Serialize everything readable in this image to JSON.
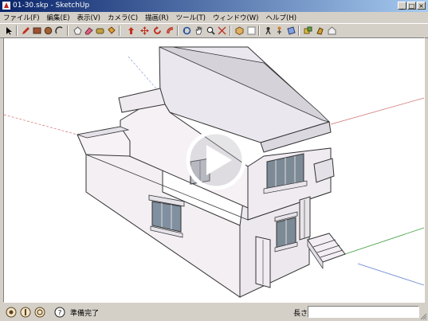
{
  "window": {
    "title": "01-30.skp - SketchUp",
    "controls": {
      "minimize": "_",
      "maximize": "□",
      "close": "×"
    }
  },
  "menu": [
    "ファイル(F)",
    "編集(E)",
    "表示(V)",
    "カメラ(C)",
    "描画(R)",
    "ツール(T)",
    "ウィンドウ(W)",
    "ヘルプ(H)"
  ],
  "toolbar": {
    "tools": [
      {
        "name": "select-icon"
      },
      {
        "name": "pencil-icon"
      },
      {
        "name": "rectangle-icon"
      },
      {
        "name": "circle-icon"
      },
      {
        "name": "arc-icon"
      },
      {
        "name": "polygon-icon"
      },
      {
        "name": "eraser-icon"
      },
      {
        "name": "tape-measure-icon"
      },
      {
        "name": "paint-bucket-icon"
      },
      {
        "name": "push-pull-icon"
      },
      {
        "name": "move-icon"
      },
      {
        "name": "rotate-icon"
      },
      {
        "name": "offset-icon"
      },
      {
        "name": "orbit-icon"
      },
      {
        "name": "pan-icon"
      },
      {
        "name": "zoom-icon"
      },
      {
        "name": "zoom-extents-icon"
      },
      {
        "name": "iso-view-icon"
      },
      {
        "name": "walk-icon"
      },
      {
        "name": "look-around-icon"
      },
      {
        "name": "position-camera-icon"
      },
      {
        "name": "section-plane-icon"
      },
      {
        "name": "components-icon"
      },
      {
        "name": "materials-icon"
      },
      {
        "name": "warehouse-icon"
      }
    ]
  },
  "statusbar": {
    "status_text": "準備完了",
    "length_label": "長さ",
    "length_value": ""
  },
  "colors": {
    "titlebar_start": "#0a246a",
    "titlebar_end": "#a6caf0",
    "chrome": "#d4d0c8",
    "wall": "#f2eef2",
    "roof": "#e8e4ec",
    "axis_red": "#d06060",
    "axis_green": "#3a9a3a",
    "axis_blue": "#6080d0"
  }
}
